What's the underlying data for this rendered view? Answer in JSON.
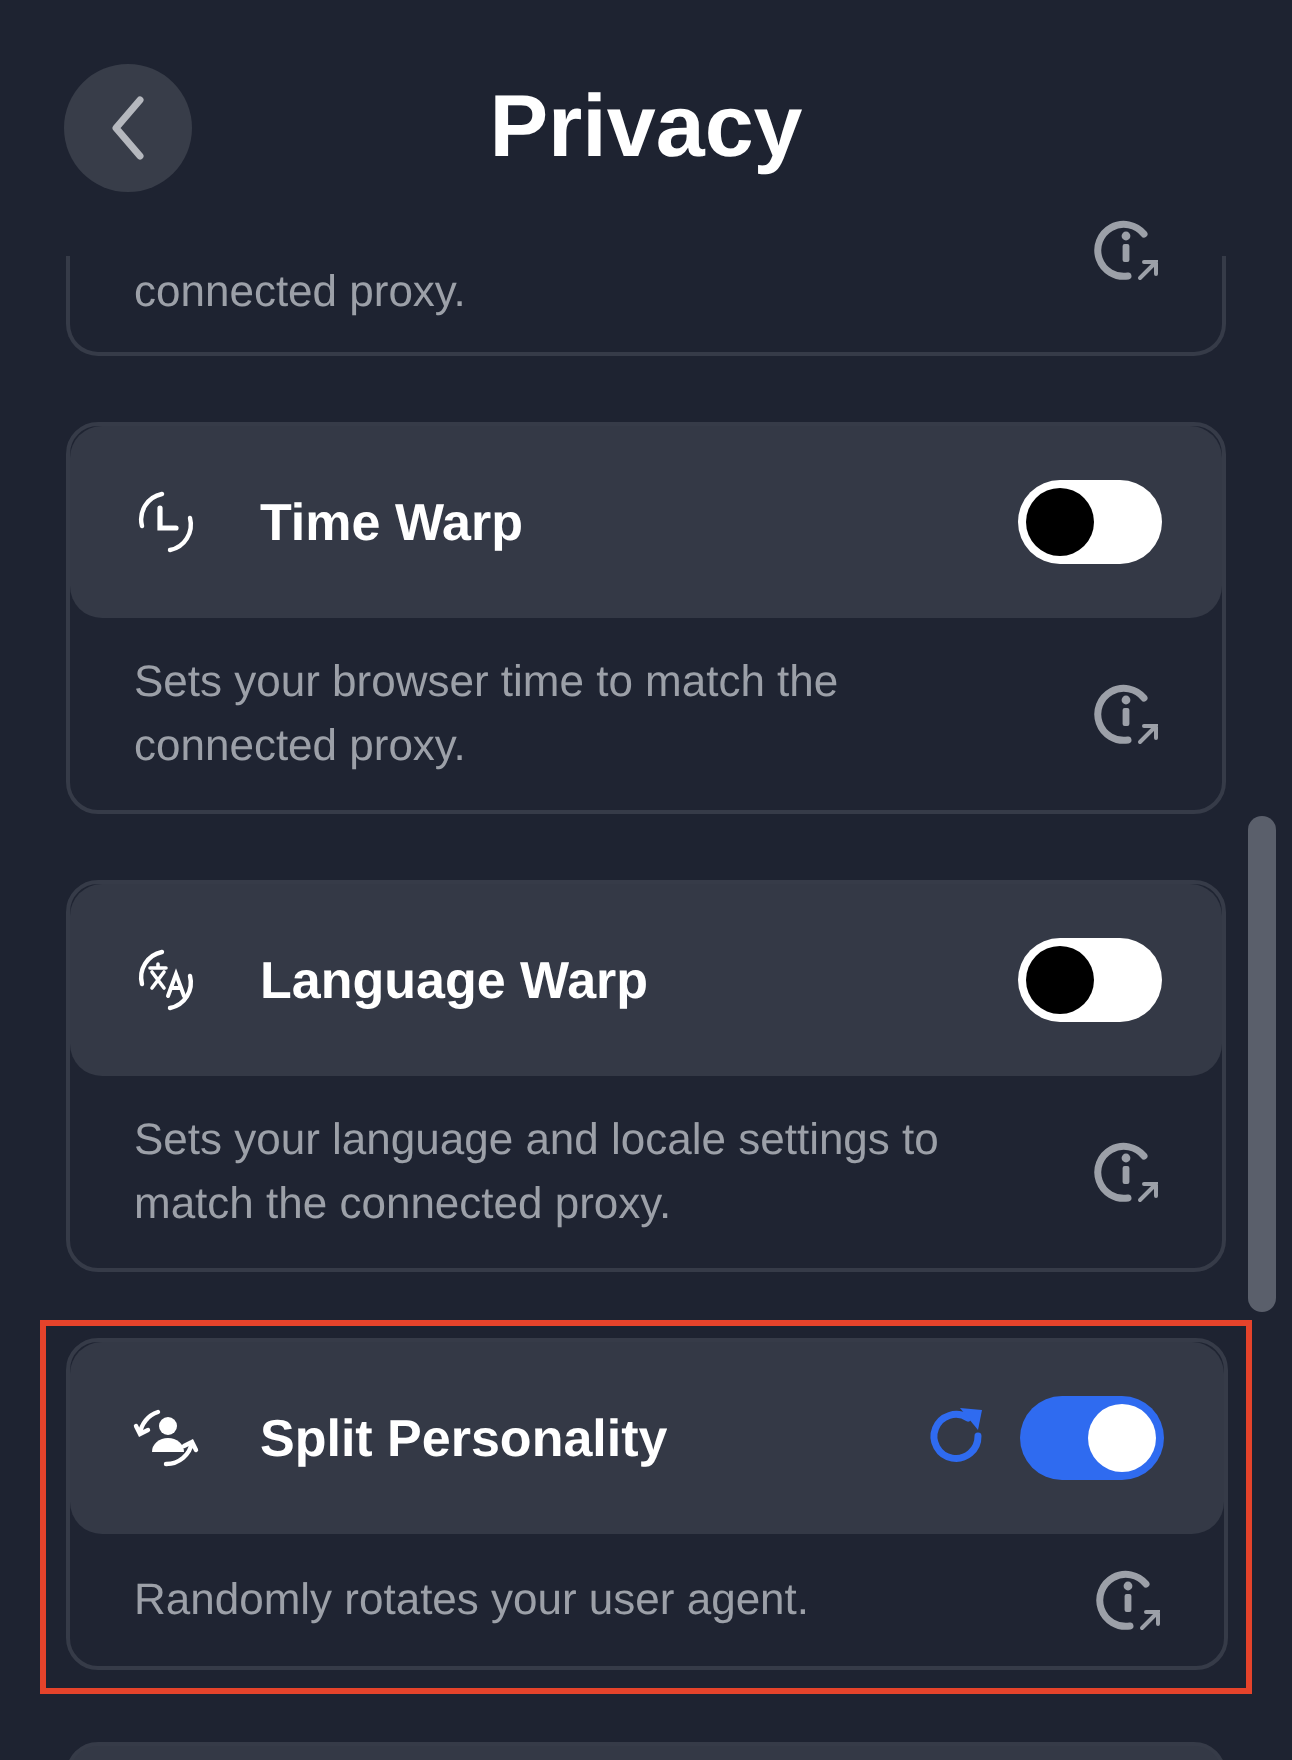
{
  "header": {
    "title": "Privacy"
  },
  "partial_card": {
    "description": "connected proxy."
  },
  "settings": [
    {
      "kind": "toggle",
      "title": "Time Warp",
      "description": "Sets your browser time to match the connected proxy.",
      "on": false,
      "highlighted": false
    },
    {
      "kind": "toggle",
      "title": "Language Warp",
      "description": "Sets your language and locale settings to match the connected proxy.",
      "on": false,
      "highlighted": false
    },
    {
      "kind": "toggle-with-refresh",
      "title": "Split Personality",
      "description": "Randomly rotates your user agent.",
      "on": true,
      "highlighted": true
    }
  ]
}
